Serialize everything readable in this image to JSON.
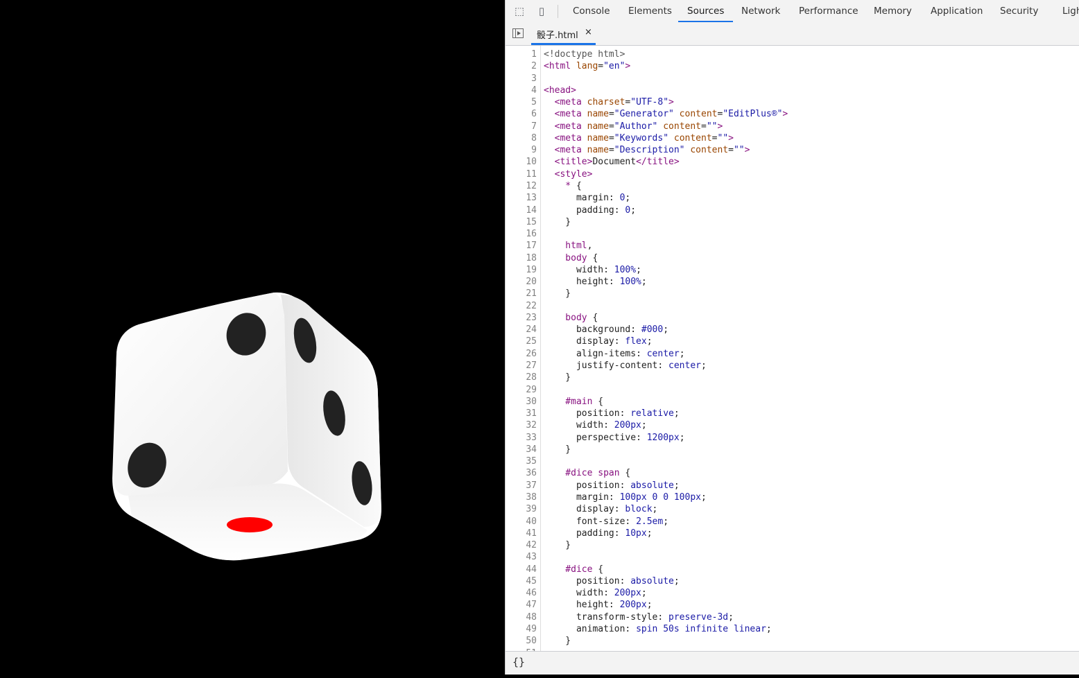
{
  "devtools": {
    "tools": [
      {
        "icon": "inspect-element-icon"
      },
      {
        "icon": "device-toolbar-icon"
      }
    ],
    "tabs": [
      {
        "label": "Console",
        "active": false
      },
      {
        "label": "Elements",
        "active": false
      },
      {
        "label": "Sources",
        "active": true
      },
      {
        "label": "Network",
        "active": false
      },
      {
        "label": "Performance",
        "active": false
      },
      {
        "label": "Memory",
        "active": false
      },
      {
        "label": "Application",
        "active": false
      },
      {
        "label": "Security",
        "active": false
      },
      {
        "label": "Ligh",
        "active": false
      }
    ],
    "file_tab": {
      "name": "骰子.html",
      "close": "×"
    },
    "pretty_print_label": "{}",
    "colors": {
      "accent": "#1a73e8",
      "tag": "#881280",
      "attribute": "#994500",
      "string": "#1a1aa6"
    }
  },
  "dice": {
    "pip_color": "#222222",
    "one_pip_color": "#ff0000",
    "face_color": "#ffffff"
  },
  "code": [
    [
      [
        "dt",
        "<!doctype html>"
      ]
    ],
    [
      [
        "t",
        "<html"
      ],
      [
        "a",
        " lang"
      ],
      [
        "p",
        "="
      ],
      [
        "s",
        "\"en\""
      ],
      [
        "t",
        ">"
      ]
    ],
    [],
    [
      [
        "t",
        "<head>"
      ]
    ],
    [
      [
        "t",
        "  <meta"
      ],
      [
        "a",
        " charset"
      ],
      [
        "p",
        "="
      ],
      [
        "s",
        "\"UTF-8\""
      ],
      [
        "t",
        ">"
      ]
    ],
    [
      [
        "t",
        "  <meta"
      ],
      [
        "a",
        " name"
      ],
      [
        "p",
        "="
      ],
      [
        "s",
        "\"Generator\""
      ],
      [
        "a",
        " content"
      ],
      [
        "p",
        "="
      ],
      [
        "s",
        "\"EditPlus®\""
      ],
      [
        "t",
        ">"
      ]
    ],
    [
      [
        "t",
        "  <meta"
      ],
      [
        "a",
        " name"
      ],
      [
        "p",
        "="
      ],
      [
        "s",
        "\"Author\""
      ],
      [
        "a",
        " content"
      ],
      [
        "p",
        "="
      ],
      [
        "s",
        "\"\""
      ],
      [
        "t",
        ">"
      ]
    ],
    [
      [
        "t",
        "  <meta"
      ],
      [
        "a",
        " name"
      ],
      [
        "p",
        "="
      ],
      [
        "s",
        "\"Keywords\""
      ],
      [
        "a",
        " content"
      ],
      [
        "p",
        "="
      ],
      [
        "s",
        "\"\""
      ],
      [
        "t",
        ">"
      ]
    ],
    [
      [
        "t",
        "  <meta"
      ],
      [
        "a",
        " name"
      ],
      [
        "p",
        "="
      ],
      [
        "s",
        "\"Description\""
      ],
      [
        "a",
        " content"
      ],
      [
        "p",
        "="
      ],
      [
        "s",
        "\"\""
      ],
      [
        "t",
        ">"
      ]
    ],
    [
      [
        "t",
        "  <title>"
      ],
      [
        "p",
        "Document"
      ],
      [
        "t",
        "</title>"
      ]
    ],
    [
      [
        "t",
        "  <style>"
      ]
    ],
    [
      [
        "sel",
        "    *"
      ],
      [
        "p",
        " {"
      ]
    ],
    [
      [
        "prop",
        "      margin"
      ],
      [
        "p",
        ": "
      ],
      [
        "v",
        "0"
      ],
      [
        "p",
        ";"
      ]
    ],
    [
      [
        "prop",
        "      padding"
      ],
      [
        "p",
        ": "
      ],
      [
        "v",
        "0"
      ],
      [
        "p",
        ";"
      ]
    ],
    [
      [
        "p",
        "    }"
      ]
    ],
    [],
    [
      [
        "sel",
        "    html"
      ],
      [
        "p",
        ","
      ]
    ],
    [
      [
        "sel",
        "    body"
      ],
      [
        "p",
        " {"
      ]
    ],
    [
      [
        "prop",
        "      width"
      ],
      [
        "p",
        ": "
      ],
      [
        "v",
        "100%"
      ],
      [
        "p",
        ";"
      ]
    ],
    [
      [
        "prop",
        "      height"
      ],
      [
        "p",
        ": "
      ],
      [
        "v",
        "100%"
      ],
      [
        "p",
        ";"
      ]
    ],
    [
      [
        "p",
        "    }"
      ]
    ],
    [],
    [
      [
        "sel",
        "    body"
      ],
      [
        "p",
        " {"
      ]
    ],
    [
      [
        "prop",
        "      background"
      ],
      [
        "p",
        ": "
      ],
      [
        "v",
        "#000"
      ],
      [
        "p",
        ";"
      ]
    ],
    [
      [
        "prop",
        "      display"
      ],
      [
        "p",
        ": "
      ],
      [
        "v",
        "flex"
      ],
      [
        "p",
        ";"
      ]
    ],
    [
      [
        "prop",
        "      align-items"
      ],
      [
        "p",
        ": "
      ],
      [
        "v",
        "center"
      ],
      [
        "p",
        ";"
      ]
    ],
    [
      [
        "prop",
        "      justify-content"
      ],
      [
        "p",
        ": "
      ],
      [
        "v",
        "center"
      ],
      [
        "p",
        ";"
      ]
    ],
    [
      [
        "p",
        "    }"
      ]
    ],
    [],
    [
      [
        "sel",
        "    #main"
      ],
      [
        "p",
        " {"
      ]
    ],
    [
      [
        "prop",
        "      position"
      ],
      [
        "p",
        ": "
      ],
      [
        "v",
        "relative"
      ],
      [
        "p",
        ";"
      ]
    ],
    [
      [
        "prop",
        "      width"
      ],
      [
        "p",
        ": "
      ],
      [
        "v",
        "200px"
      ],
      [
        "p",
        ";"
      ]
    ],
    [
      [
        "prop",
        "      perspective"
      ],
      [
        "p",
        ": "
      ],
      [
        "v",
        "1200px"
      ],
      [
        "p",
        ";"
      ]
    ],
    [
      [
        "p",
        "    }"
      ]
    ],
    [],
    [
      [
        "sel",
        "    #dice span"
      ],
      [
        "p",
        " {"
      ]
    ],
    [
      [
        "prop",
        "      position"
      ],
      [
        "p",
        ": "
      ],
      [
        "v",
        "absolute"
      ],
      [
        "p",
        ";"
      ]
    ],
    [
      [
        "prop",
        "      margin"
      ],
      [
        "p",
        ": "
      ],
      [
        "v",
        "100px 0 0 100px"
      ],
      [
        "p",
        ";"
      ]
    ],
    [
      [
        "prop",
        "      display"
      ],
      [
        "p",
        ": "
      ],
      [
        "v",
        "block"
      ],
      [
        "p",
        ";"
      ]
    ],
    [
      [
        "prop",
        "      font-size"
      ],
      [
        "p",
        ": "
      ],
      [
        "v",
        "2.5em"
      ],
      [
        "p",
        ";"
      ]
    ],
    [
      [
        "prop",
        "      padding"
      ],
      [
        "p",
        ": "
      ],
      [
        "v",
        "10px"
      ],
      [
        "p",
        ";"
      ]
    ],
    [
      [
        "p",
        "    }"
      ]
    ],
    [],
    [
      [
        "sel",
        "    #dice"
      ],
      [
        "p",
        " {"
      ]
    ],
    [
      [
        "prop",
        "      position"
      ],
      [
        "p",
        ": "
      ],
      [
        "v",
        "absolute"
      ],
      [
        "p",
        ";"
      ]
    ],
    [
      [
        "prop",
        "      width"
      ],
      [
        "p",
        ": "
      ],
      [
        "v",
        "200px"
      ],
      [
        "p",
        ";"
      ]
    ],
    [
      [
        "prop",
        "      height"
      ],
      [
        "p",
        ": "
      ],
      [
        "v",
        "200px"
      ],
      [
        "p",
        ";"
      ]
    ],
    [
      [
        "prop",
        "      transform-style"
      ],
      [
        "p",
        ": "
      ],
      [
        "v",
        "preserve-3d"
      ],
      [
        "p",
        ";"
      ]
    ],
    [
      [
        "prop",
        "      animation"
      ],
      [
        "p",
        ": "
      ],
      [
        "v",
        "spin 50s infinite linear"
      ],
      [
        "p",
        ";"
      ]
    ],
    [
      [
        "p",
        "    }"
      ]
    ],
    []
  ]
}
